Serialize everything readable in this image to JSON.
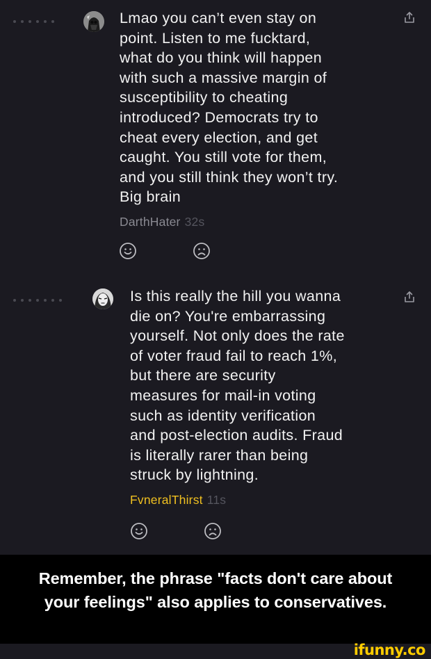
{
  "thread": {
    "comments": [
      {
        "avatar_icon": "vader-avatar-icon",
        "text": "Lmao you can’t even stay on\npoint. Listen to me fucktard,\nwhat do you think will happen\nwith such a massive margin of\nsusceptibility to cheating\nintroduced? Democrats try to\ncheat every election, and get\ncaught. You still vote for them,\nand you still think they won’t try.\nBig brain",
        "username": "DarthHater",
        "time": "32s",
        "username_color": "#8a8a92",
        "reactions": [
          "smile-icon",
          "frown-icon"
        ],
        "share_icon": "share-icon"
      },
      {
        "avatar_icon": "user-avatar-icon",
        "text": "Is this really the hill you wanna\ndie on? You're embarrassing\nyourself. Not only does the rate\nof voter fraud fail to reach 1%,\nbut there are security\nmeasures for mail-in voting\nsuch as identity verification\nand post-election audits. Fraud\nis literally rarer than being\nstruck by lightning.",
        "username": "FvneralThirst",
        "time": "11s",
        "username_color": "#f0c020",
        "reactions": [
          "smile-icon",
          "frown-icon"
        ],
        "share_icon": "share-icon"
      }
    ]
  },
  "caption": {
    "text": "Remember, the phrase \"facts don't care about\nyour feelings\" also applies to conservatives."
  },
  "watermark": {
    "text": "ifunny.co"
  },
  "colors": {
    "thread_background": "#1b1a21",
    "caption_background": "#000000",
    "watermark": "#ffcc00"
  }
}
